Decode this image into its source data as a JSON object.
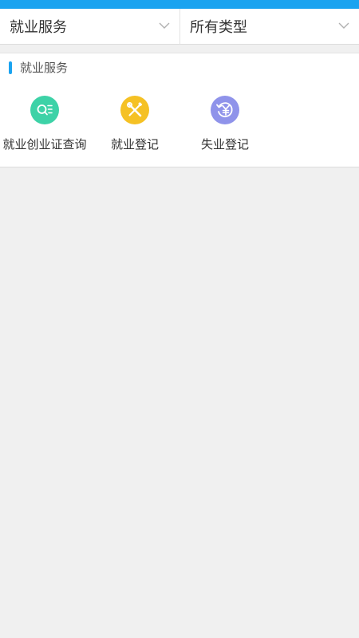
{
  "colors": {
    "accent": "#1aa3f0",
    "query_icon": "#3dd2a7",
    "register_icon": "#f5c124",
    "unemployment_icon": "#8f93ea"
  },
  "filters": {
    "category": {
      "label": "就业服务",
      "icon": "chevron-down-icon"
    },
    "type": {
      "label": "所有类型",
      "icon": "chevron-down-icon"
    }
  },
  "section": {
    "title": "就业服务"
  },
  "services": [
    {
      "label": "就业创业证查询",
      "icon": "search-list-icon"
    },
    {
      "label": "就业登记",
      "icon": "wrench-screwdriver-icon"
    },
    {
      "label": "失业登记",
      "icon": "yuan-refresh-icon"
    }
  ]
}
